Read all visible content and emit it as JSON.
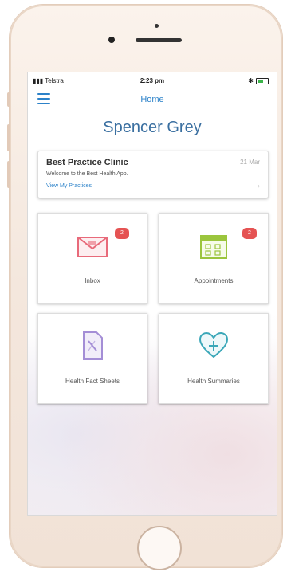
{
  "status_bar": {
    "carrier": "Telstra",
    "time": "2:23 pm",
    "battery_level": 0.6
  },
  "nav": {
    "title": "Home"
  },
  "user": {
    "name": "Spencer Grey"
  },
  "clinic_card": {
    "title": "Best Practice Clinic",
    "date": "21 Mar",
    "message": "Welcome to the Best Health App.",
    "link": "View My Practices"
  },
  "tiles": {
    "inbox": {
      "label": "Inbox",
      "badge": "2",
      "icon": "envelope-icon"
    },
    "appointments": {
      "label": "Appointments",
      "badge": "2",
      "icon": "calendar-icon"
    },
    "fact_sheets": {
      "label": "Health Fact Sheets",
      "icon": "document-icon"
    },
    "summaries": {
      "label": "Health Summaries",
      "icon": "heart-plus-icon"
    }
  },
  "colors": {
    "accent": "#2c82c9",
    "badge": "#e55353",
    "inbox_icon": "#e86a7a",
    "calendar_icon": "#9bc53d",
    "document_icon": "#a48ed6",
    "heart_icon": "#3aa7b8"
  }
}
